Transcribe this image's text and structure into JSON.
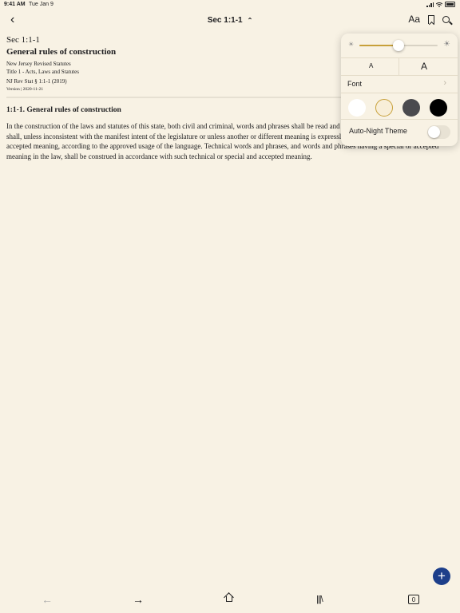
{
  "status_bar": {
    "time": "9:41 AM",
    "date": "Tue Jan 9"
  },
  "nav": {
    "title": "Sec 1:1-1",
    "back_icon": "chevron-left-icon",
    "text_settings_label": "Aa"
  },
  "document": {
    "section_label": "Sec 1:1-1",
    "title": "General rules of construction",
    "source": "New Jersey Revised Statutes",
    "title_line": "Title 1 - Acts, Laws and Statutes",
    "citation": "NJ Rev Stat § 1:1-1 (2019)",
    "version": "Version | 2020-11-21",
    "section_heading": "1:1-1. General rules of construction",
    "body": "In the construction of the laws and statutes of this state, both civil and criminal, words and phrases shall be read and construed with their context, and shall, unless inconsistent with the manifest intent of the legislature or unless another or different meaning is expressly indicated, be given their generally accepted meaning, according to the approved usage of the language. Technical words and phrases, and words and phrases having a special or accepted meaning in the law, shall be construed in accordance with such technical or special and accepted meaning."
  },
  "appearance_popover": {
    "brightness": 0.5,
    "small_text_label": "A",
    "large_text_label": "A",
    "font_label": "Font",
    "themes": [
      {
        "name": "white",
        "color": "#ffffff"
      },
      {
        "name": "sepia",
        "color": "#f8eed8",
        "selected": true
      },
      {
        "name": "gray",
        "color": "#4a4a4e"
      },
      {
        "name": "black",
        "color": "#000000"
      }
    ],
    "auto_night_label": "Auto-Night Theme",
    "auto_night_enabled": false
  },
  "fab": {
    "label": "+"
  },
  "toolbar": {
    "tabs_count": "0"
  },
  "colors": {
    "background": "#f8f2e4",
    "accent": "#c7a03a",
    "fab": "#1d3f8a"
  }
}
